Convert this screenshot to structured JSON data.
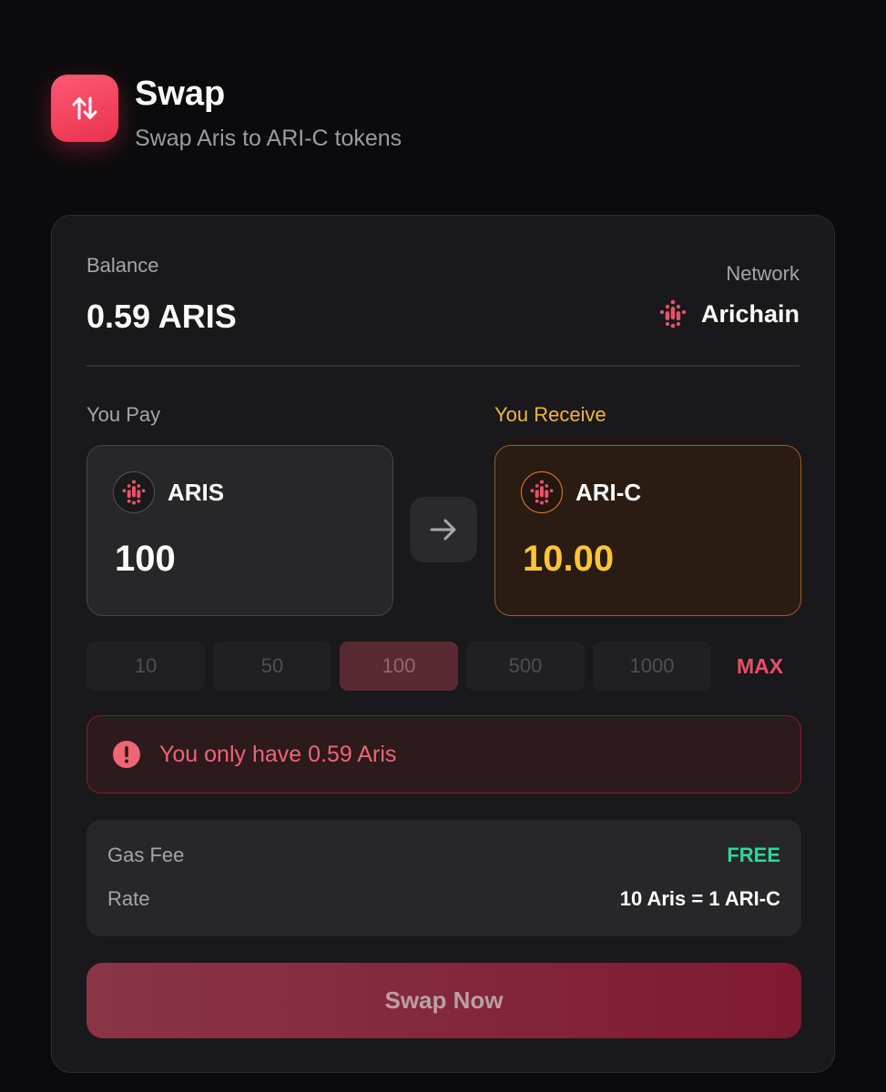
{
  "header": {
    "title": "Swap",
    "subtitle": "Swap Aris to ARI-C tokens",
    "icon": "swap-arrows-icon"
  },
  "balance": {
    "label": "Balance",
    "value": "0.59 ARIS"
  },
  "network": {
    "label": "Network",
    "name": "Arichain",
    "icon": "arichain-logo-icon"
  },
  "pay": {
    "label": "You Pay",
    "token": "ARIS",
    "amount": "100"
  },
  "receive": {
    "label": "You Receive",
    "token": "ARI-C",
    "amount": "10.00"
  },
  "presets": {
    "options": [
      "10",
      "50",
      "100",
      "500",
      "1000"
    ],
    "selected": "100",
    "max_label": "MAX"
  },
  "error": {
    "message": "You only have 0.59 Aris",
    "icon": "alert-circle-icon"
  },
  "info": {
    "gas_fee_label": "Gas Fee",
    "gas_fee_value": "FREE",
    "rate_label": "Rate",
    "rate_value": "10 Aris = 1 ARI-C"
  },
  "swap_button": {
    "label": "Swap Now"
  },
  "colors": {
    "accent": "#ee4d68",
    "receive_accent": "#ffc534",
    "success": "#2fd69a",
    "error": "#f06474"
  }
}
